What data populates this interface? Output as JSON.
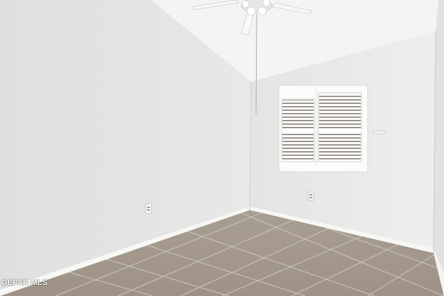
{
  "watermark": {
    "text": "GEPAR MLS"
  },
  "colors": {
    "left_wall": "#e3e4e1",
    "back_wall": "#ebebe9",
    "right_wall": "#e6e6e4",
    "ceiling": "#f4f4f3",
    "baseboard": "#f6f6f4",
    "tile": "#a79c8f",
    "grout": "#c9c1b6",
    "window_frame": "#fbfbfb"
  },
  "icons": [
    "ceiling-fan-icon",
    "outlet-icon",
    "light-switch-icon",
    "window-shutter-icon"
  ]
}
